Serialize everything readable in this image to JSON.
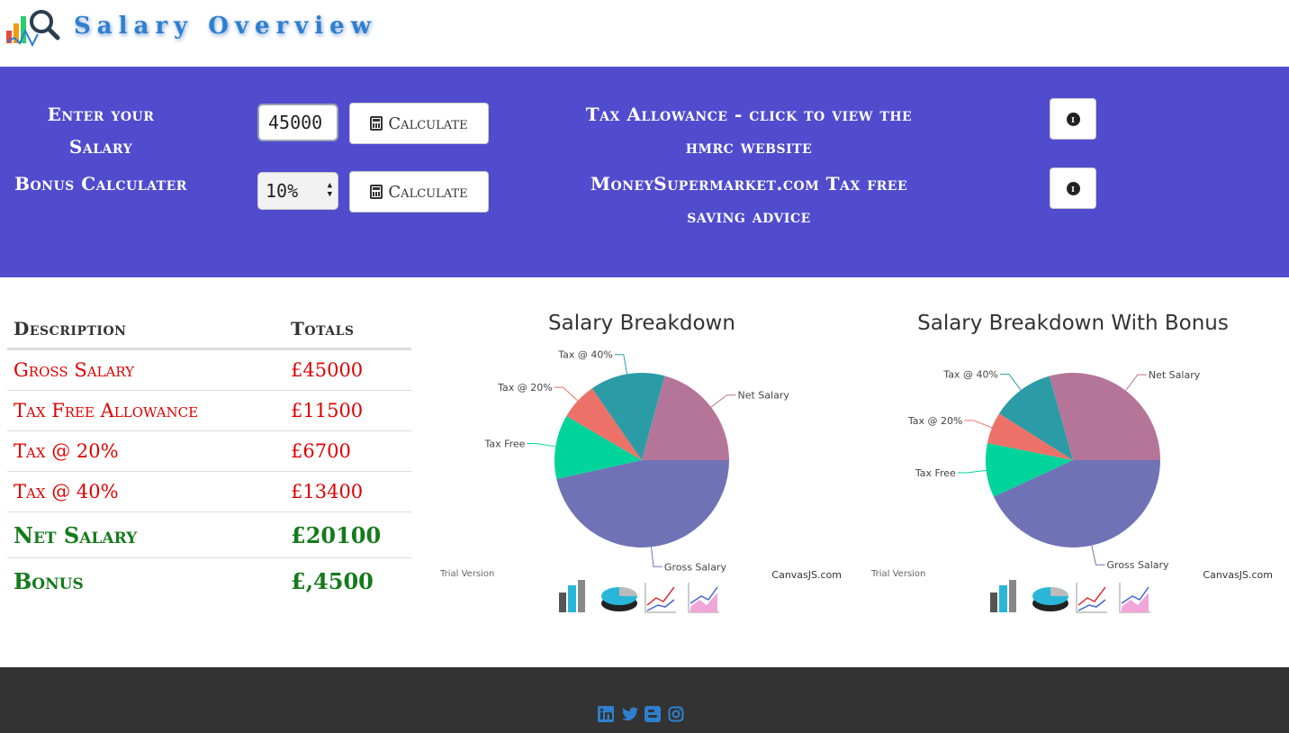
{
  "header": {
    "title": "Salary Overview"
  },
  "form": {
    "salary_label": "Enter your Salary",
    "salary_value": "45000",
    "calculate_label": "Calculate",
    "bonus_label": "Bonus Calculater",
    "bonus_selected": "10%",
    "bonus_calculate_label": "Calculate",
    "tax_allowance_label": "Tax Allowance - click to view the hmrc website",
    "moneysupermarket_label": "MoneySupermarket.com Tax free saving advice"
  },
  "table": {
    "headers": [
      "Description",
      "Totals"
    ],
    "rows": [
      {
        "label": "Gross Salary",
        "value": "£45000"
      },
      {
        "label": "Tax Free Allowance",
        "value": "£11500"
      },
      {
        "label": "Tax @ 20%",
        "value": "£6700"
      },
      {
        "label": "Tax @ 40%",
        "value": "£13400"
      },
      {
        "label": "Net Salary",
        "value": "£20100"
      },
      {
        "label": "Bonus",
        "value": "£,4500"
      }
    ]
  },
  "charts": {
    "watermark_left": "Trial Version",
    "watermark_right": "CanvasJS.com"
  },
  "colors": {
    "band": "#514ccd",
    "title": "#2f7fd0",
    "red_text": "#e00000",
    "green_text": "#157a1c",
    "footer": "#333333",
    "social": "#2f7fd0"
  },
  "chart_data": [
    {
      "type": "pie",
      "title": "Salary Breakdown",
      "slices": [
        {
          "label": "Gross Salary",
          "value": 45000,
          "color": "#6f73b5"
        },
        {
          "label": "Tax Free",
          "value": 11500,
          "color": "#01d49a"
        },
        {
          "label": "Tax @ 20%",
          "value": 6700,
          "color": "#ec7169"
        },
        {
          "label": "Tax @ 40%",
          "value": 13400,
          "color": "#2b9ba6"
        },
        {
          "label": "Net Salary",
          "value": 20100,
          "color": "#b57599"
        }
      ]
    },
    {
      "type": "pie",
      "title": "Salary Breakdown With Bonus",
      "slices": [
        {
          "label": "Gross Salary",
          "value": 49500,
          "color": "#6f73b5"
        },
        {
          "label": "Tax Free",
          "value": 11500,
          "color": "#01d49a"
        },
        {
          "label": "Tax @ 20%",
          "value": 6700,
          "color": "#ec7169"
        },
        {
          "label": "Tax @ 40%",
          "value": 13400,
          "color": "#2b9ba6"
        },
        {
          "label": "Net Salary",
          "value": 33700,
          "color": "#b57599"
        }
      ]
    }
  ]
}
